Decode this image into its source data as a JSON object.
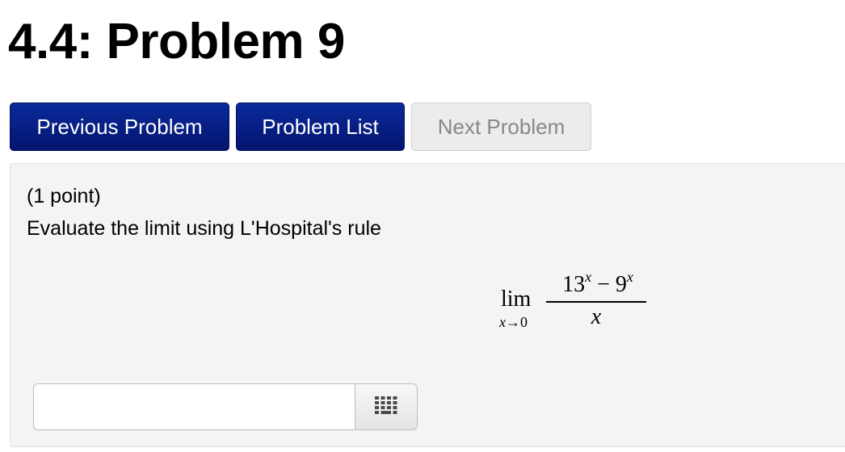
{
  "page_title": "4.4: Problem 9",
  "nav": {
    "previous_label": "Previous Problem",
    "list_label": "Problem List",
    "next_label": "Next Problem",
    "next_disabled": true
  },
  "problem": {
    "points": "(1 point)",
    "prompt": "Evaluate the limit using L'Hospital's rule",
    "math": {
      "lim": "lim",
      "lim_var": "x",
      "lim_arrow": "→",
      "lim_target": "0",
      "num_base1": "13",
      "num_exp1": "x",
      "num_op": " − ",
      "num_base2": "9",
      "num_exp2": "x",
      "denominator": "x"
    }
  },
  "answer": {
    "value": "",
    "placeholder": "",
    "keypad_icon": "keypad-icon"
  },
  "colors": {
    "primary_button": "#0a2a9a",
    "disabled_button": "#ececec",
    "problem_background": "#f4f4f4"
  }
}
